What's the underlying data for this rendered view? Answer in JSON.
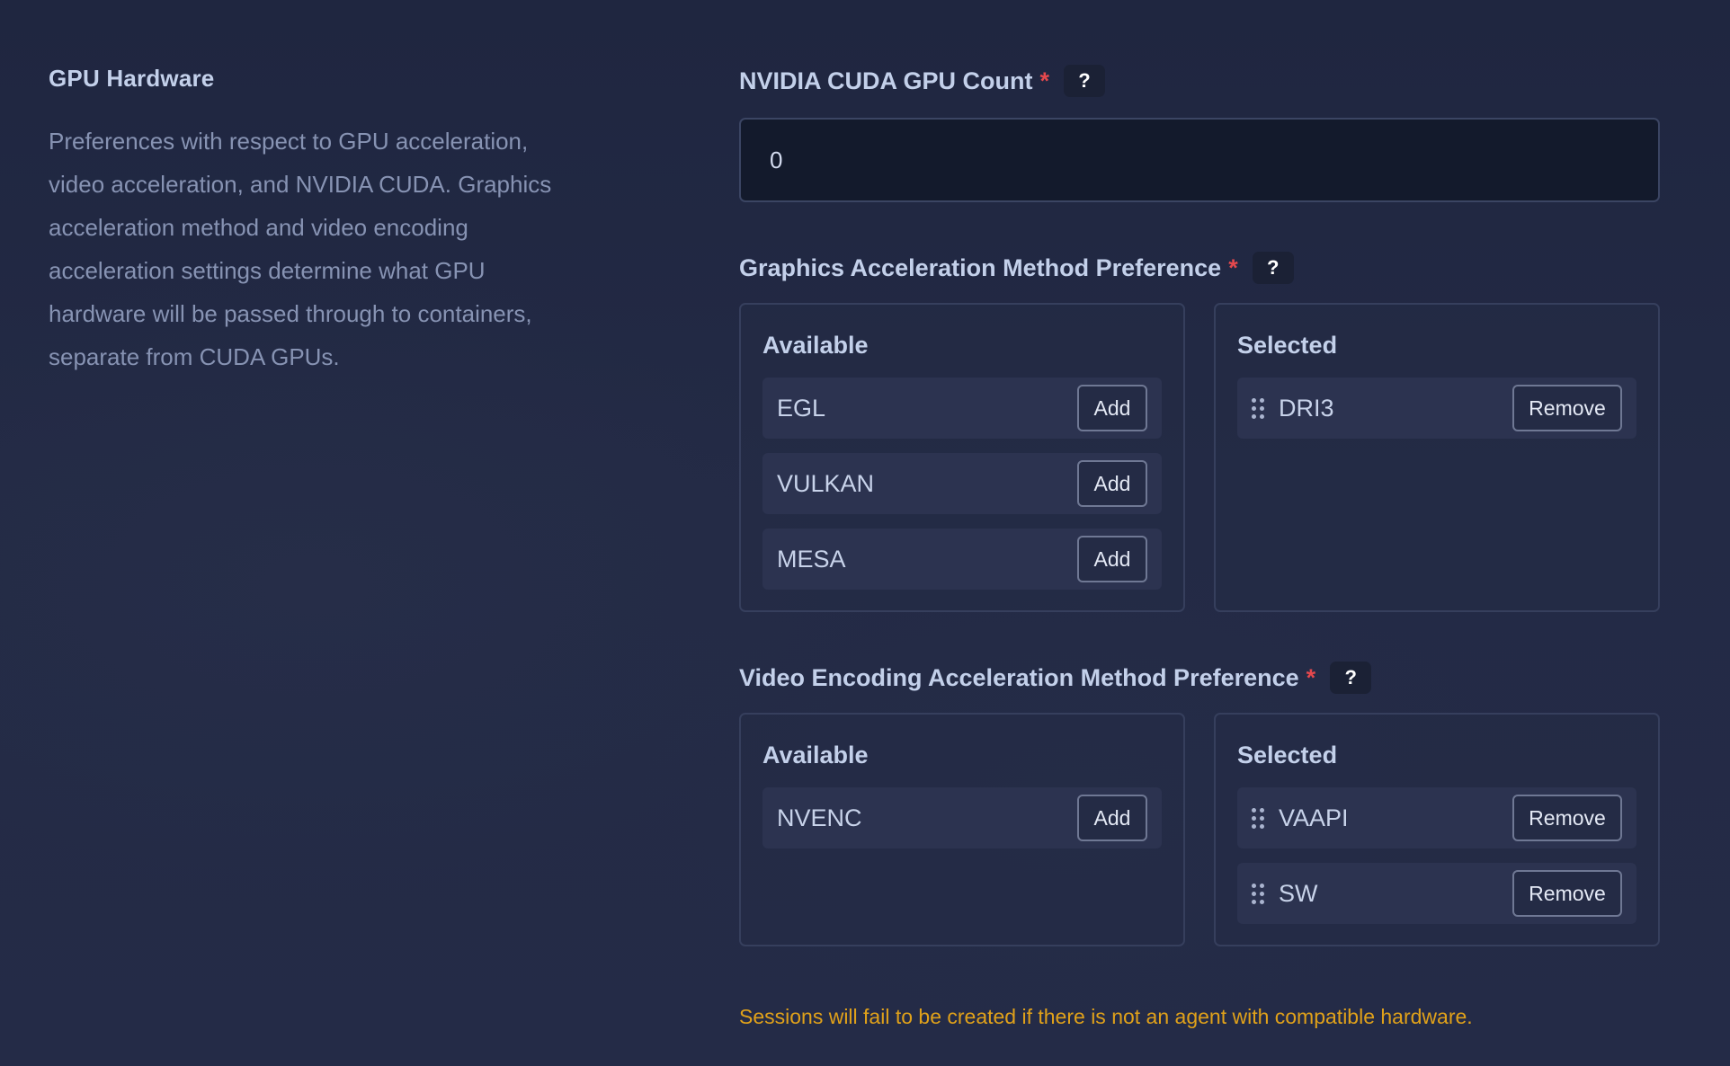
{
  "section": {
    "title": "GPU Hardware",
    "description": "Preferences with respect to GPU acceleration, video acceleration, and NVIDIA CUDA. Graphics acceleration method and video encoding acceleration settings determine what GPU hardware will be passed through to containers, separate from CUDA GPUs."
  },
  "cuda": {
    "label": "NVIDIA CUDA GPU Count",
    "required_mark": "*",
    "help": "?",
    "value": "0"
  },
  "graphics": {
    "label": "Graphics Acceleration Method Preference",
    "required_mark": "*",
    "help": "?",
    "available_title": "Available",
    "selected_title": "Selected",
    "available": [
      {
        "label": "EGL",
        "button": "Add"
      },
      {
        "label": "VULKAN",
        "button": "Add"
      },
      {
        "label": "MESA",
        "button": "Add"
      }
    ],
    "selected": [
      {
        "label": "DRI3",
        "button": "Remove"
      }
    ]
  },
  "video": {
    "label": "Video Encoding Acceleration Method Preference",
    "required_mark": "*",
    "help": "?",
    "available_title": "Available",
    "selected_title": "Selected",
    "available": [
      {
        "label": "NVENC",
        "button": "Add"
      }
    ],
    "selected": [
      {
        "label": "VAAPI",
        "button": "Remove"
      },
      {
        "label": "SW",
        "button": "Remove"
      }
    ]
  },
  "warning": "Sessions will fail to be created if there is not an agent with compatible hardware.",
  "colors": {
    "background": "#222943",
    "required": "#e5484d",
    "warning": "#e0a11a",
    "input_bg": "#131a2c"
  },
  "icons": {
    "drag_handle": "drag-handle-icon",
    "help": "help-icon"
  }
}
